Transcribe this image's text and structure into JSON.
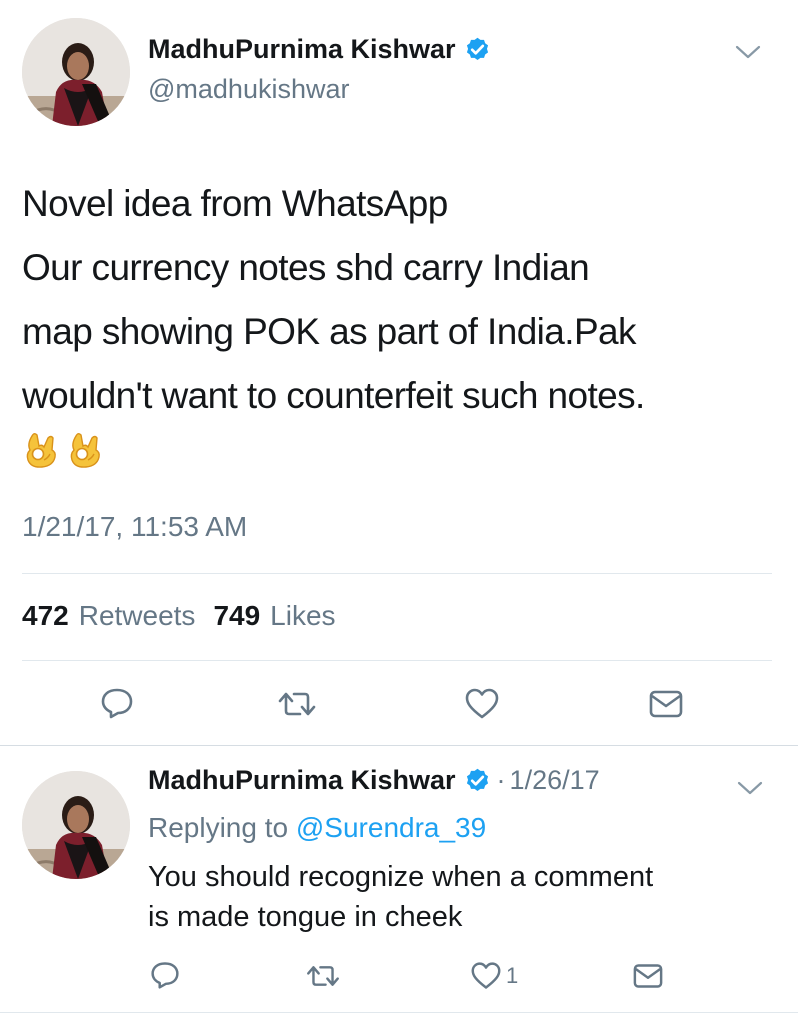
{
  "main_tweet": {
    "author_name": "MadhuPurnima Kishwar",
    "handle": "@madhukishwar",
    "text_lines": [
      "Novel idea from WhatsApp",
      "Our currency notes shd carry Indian",
      "map showing POK as part of India.Pak",
      "wouldn't want to counterfeit such notes."
    ],
    "emoji": [
      "ok-hand",
      "ok-hand"
    ],
    "timestamp": "1/21/17, 11:53 AM",
    "retweets_count": "472",
    "retweets_label": "Retweets",
    "likes_count": "749",
    "likes_label": "Likes"
  },
  "reply_tweet": {
    "author_name": "MadhuPurnima Kishwar",
    "separator": "·",
    "date": "1/26/17",
    "replying_prefix": "Replying to",
    "replying_to": "@Surendra_39",
    "text_lines": [
      "You should recognize when a comment",
      "is made tongue in cheek"
    ],
    "like_count": "1"
  },
  "icons": {
    "verified": "verified-badge-icon",
    "menu": "chevron-down-icon",
    "reply": "reply-icon",
    "retweet": "retweet-icon",
    "like": "heart-icon",
    "message": "envelope-icon"
  },
  "colors": {
    "text": "#14171a",
    "secondary": "#657786",
    "link": "#1da1f2",
    "verified": "#1da1f2",
    "divider": "#e1e8ed"
  }
}
